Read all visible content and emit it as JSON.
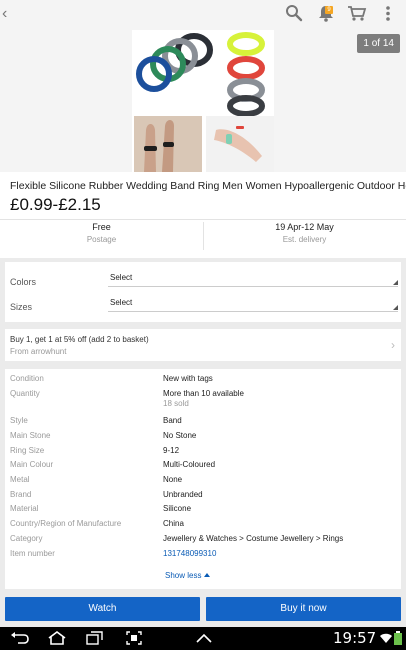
{
  "topbar": {
    "icons": [
      "back-arrow-icon",
      "search-icon",
      "bell-icon",
      "cart-icon",
      "overflow-menu-icon"
    ],
    "notification_count": "9"
  },
  "gallery": {
    "counter": "1 of 14",
    "colors": {
      "ring_black": "#2b2f36",
      "ring_blue": "#1c4f9c",
      "ring_green": "#2d8a5a",
      "ring_teal": "#2a8f8f",
      "ring_grey": "#8a8f96",
      "ring_yellow": "#d7f23a",
      "ring_red": "#e0463c",
      "ring_dark": "#3a3d42"
    }
  },
  "product": {
    "title": "Flexible Silicone Rubber Wedding Band Ring Men Women Hypoallergenic Outdoor Hot",
    "price": "£0.99-£2.15",
    "postage_value": "Free",
    "postage_label": "Postage",
    "delivery_value": "19 Apr-12 May",
    "delivery_label": "Est. delivery"
  },
  "selectors": [
    {
      "label": "Colors",
      "value": "Select"
    },
    {
      "label": "Sizes",
      "value": "Select"
    }
  ],
  "promo": {
    "text": "Buy 1, get 1 at 5% off (add 2 to basket)",
    "seller": "From arrowhunt"
  },
  "details": [
    {
      "key": "Condition",
      "value": "New with tags"
    },
    {
      "key": "Quantity",
      "value": "More than 10 available",
      "sub": "18 sold"
    },
    {
      "key": "Style",
      "value": "Band"
    },
    {
      "key": "Main Stone",
      "value": "No Stone"
    },
    {
      "key": "Ring Size",
      "value": "9-12"
    },
    {
      "key": "Main Colour",
      "value": "Multi-Coloured"
    },
    {
      "key": "Metal",
      "value": "None"
    },
    {
      "key": "Brand",
      "value": "Unbranded"
    },
    {
      "key": "Material",
      "value": "Silicone"
    },
    {
      "key": "Country/Region of Manufacture",
      "value": "China"
    },
    {
      "key": "Category",
      "value": "Jewellery & Watches > Costume Jewellery > Rings"
    },
    {
      "key": "Item number",
      "value": "131748099310"
    }
  ],
  "show_less": "Show less",
  "buttons": {
    "watch": "Watch",
    "buy": "Buy it now",
    "accent": "#1464c6"
  },
  "system": {
    "time": "19:57",
    "nav_icons": [
      "back-nav-icon",
      "home-nav-icon",
      "recents-nav-icon",
      "screenshot-icon",
      "up-chevron-icon"
    ]
  }
}
